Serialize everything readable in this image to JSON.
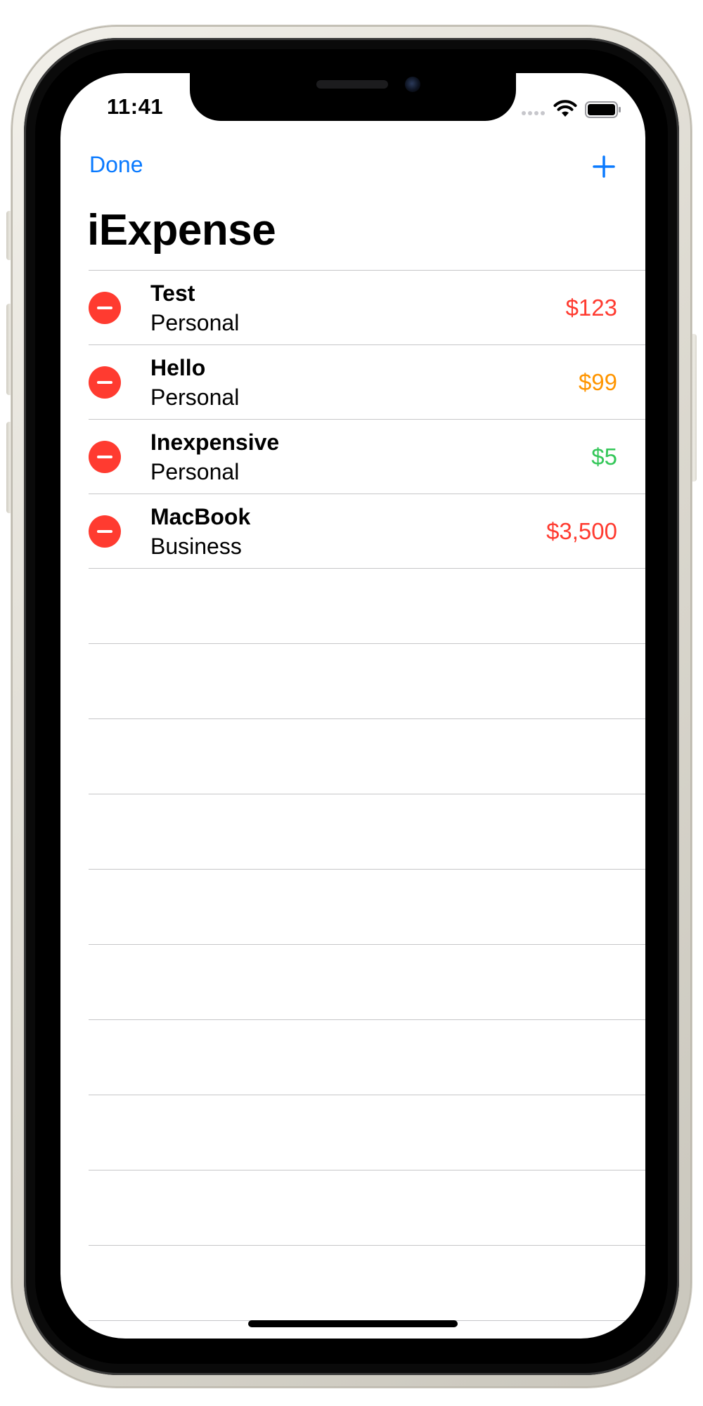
{
  "status_bar": {
    "time": "11:41"
  },
  "nav": {
    "done_label": "Done",
    "add_icon": "plus-icon",
    "title": "iExpense"
  },
  "colors": {
    "accent": "#0a7aff",
    "delete": "#ff3b30",
    "amount_high": "#ff3b30",
    "amount_medium": "#ff9500",
    "amount_low": "#34c759"
  },
  "expenses": [
    {
      "name": "Test",
      "type": "Personal",
      "amount": "$123",
      "color": "#ff3b30"
    },
    {
      "name": "Hello",
      "type": "Personal",
      "amount": "$99",
      "color": "#ff9500"
    },
    {
      "name": "Inexpensive",
      "type": "Personal",
      "amount": "$5",
      "color": "#34c759"
    },
    {
      "name": "MacBook",
      "type": "Business",
      "amount": "$3,500",
      "color": "#ff3b30"
    }
  ]
}
